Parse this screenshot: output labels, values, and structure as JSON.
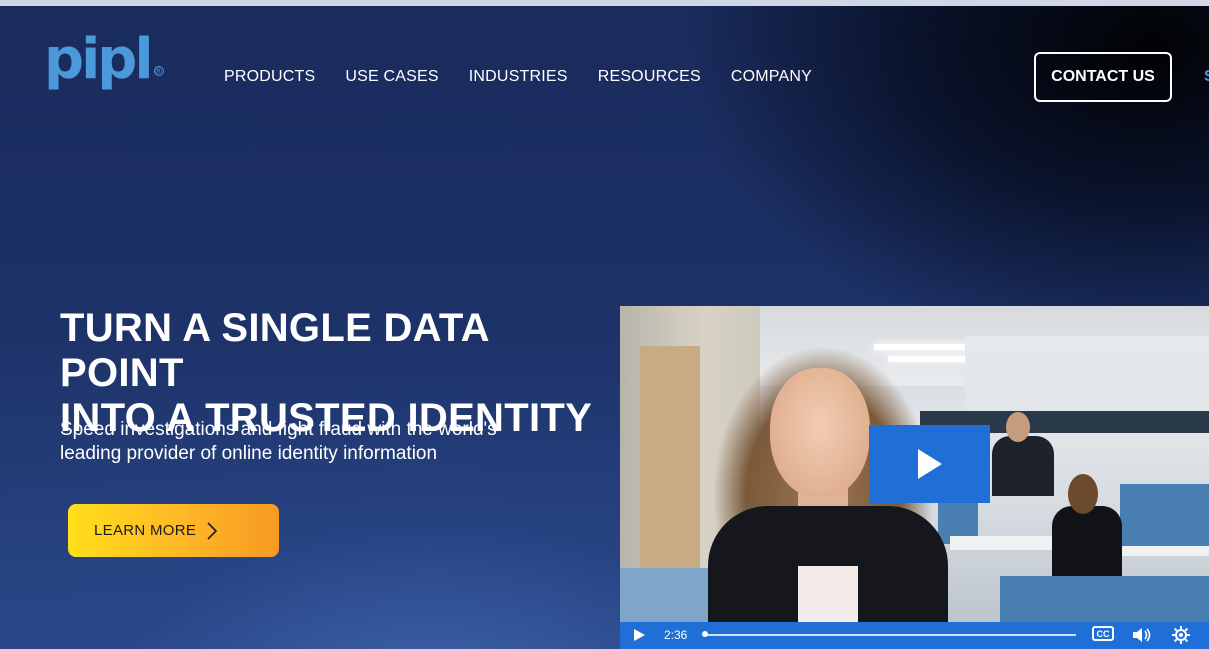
{
  "brand": {
    "logo_text": "pipl",
    "logo_mark": "®",
    "color": "#4b98db"
  },
  "nav": {
    "items": [
      {
        "label": "PRODUCTS"
      },
      {
        "label": "USE CASES"
      },
      {
        "label": "INDUSTRIES"
      },
      {
        "label": "RESOURCES"
      },
      {
        "label": "COMPANY"
      }
    ],
    "contact_label": "CONTACT US",
    "peek_text": "S"
  },
  "hero": {
    "headline_line1": "TURN A SINGLE DATA POINT",
    "headline_line2": "INTO A TRUSTED IDENTITY",
    "subtext_line1": "Speed investigations and fight fraud with the world's",
    "subtext_line2": "leading provider of online identity information",
    "cta_label": "LEARN MORE",
    "cta_icon": "chevron-right-icon"
  },
  "video": {
    "duration": "2:36",
    "progress": 0,
    "cc_label": "CC",
    "accent": "#1f6fd6",
    "icons": [
      "play-icon",
      "closed-captions-icon",
      "volume-icon",
      "settings-gear-icon"
    ]
  }
}
